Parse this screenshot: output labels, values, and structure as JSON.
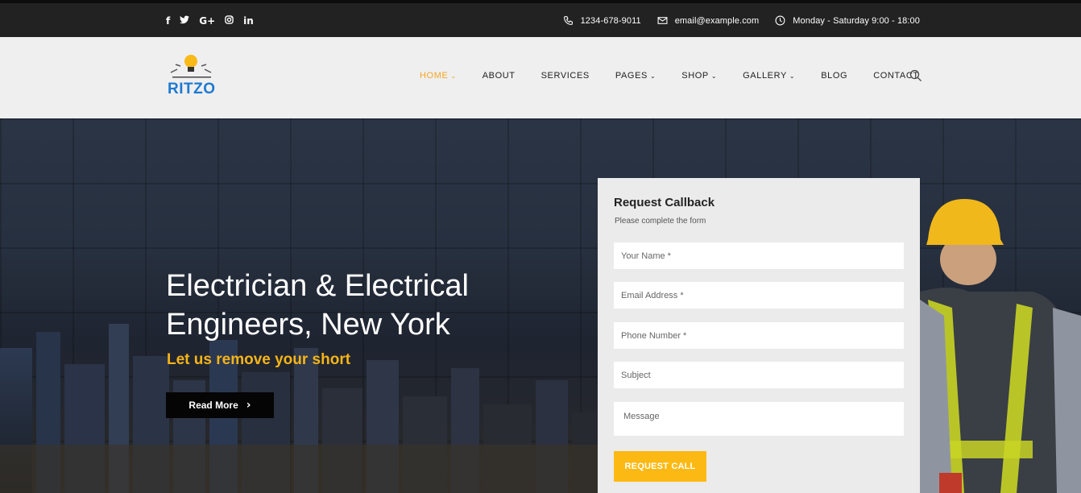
{
  "topbar": {
    "social": [
      "f",
      "🐦",
      "G+",
      "◎",
      "in"
    ],
    "phone": "1234-678-9011",
    "email": "email@example.com",
    "hours": "Monday - Saturday 9:00 - 18:00"
  },
  "header": {
    "logo_text": "RITZO",
    "nav": [
      {
        "label": "HOME",
        "chevron": "⌄",
        "active": true
      },
      {
        "label": "ABOUT",
        "chevron": ""
      },
      {
        "label": "SERVICES",
        "chevron": ""
      },
      {
        "label": "PAGES",
        "chevron": "⌄"
      },
      {
        "label": "SHOP",
        "chevron": "⌄"
      },
      {
        "label": "GALLERY",
        "chevron": "⌄"
      },
      {
        "label": "BLOG",
        "chevron": ""
      },
      {
        "label": "CONTACT",
        "chevron": ""
      }
    ]
  },
  "hero": {
    "title": "Electrician & Electrical Engineers, New York",
    "subtitle": "Let us remove your short",
    "read_more": "Read More",
    "read_more_chevron": "›"
  },
  "form": {
    "title": "Request Callback",
    "subtitle": "Please complete the form",
    "name_placeholder": "Your Name *",
    "email_placeholder": "Email Address *",
    "phone_placeholder": "Phone Number *",
    "subject_placeholder": "Subject",
    "message_placeholder": "Message",
    "submit": "REQUEST CALL"
  },
  "colors": {
    "accent": "#f5a623",
    "button_yellow": "#fdb913",
    "logo_blue": "#1e79d1",
    "topbar": "#222222"
  }
}
